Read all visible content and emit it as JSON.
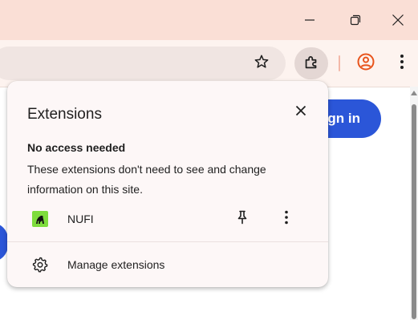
{
  "window_controls": {
    "minimize_icon": "minimize-icon",
    "restore_icon": "restore-icon",
    "close_icon": "close-icon"
  },
  "toolbar": {
    "bookmark_icon": "star-icon",
    "extensions_icon": "puzzle-icon",
    "profile_icon": "profile-icon",
    "menu_icon": "kebab-menu-icon"
  },
  "page": {
    "signin_label": "gn in"
  },
  "popup": {
    "title": "Extensions",
    "close_icon": "close-icon",
    "section_heading": "No access needed",
    "section_description": "These extensions don't need to see and change information on this site.",
    "extensions": [
      {
        "name": "NUFI",
        "icon": "nufi-gorilla-icon",
        "pin_icon": "pin-icon",
        "more_icon": "more-vert-icon"
      }
    ],
    "manage_label": "Manage extensions",
    "manage_icon": "gear-icon"
  },
  "colors": {
    "titlebar_bg": "#fadfd6",
    "toolbar_bg": "#fdf3ef",
    "accent_blue": "#2b56d8",
    "profile_accent": "#e8541c",
    "popup_bg": "#fdf7f7"
  }
}
